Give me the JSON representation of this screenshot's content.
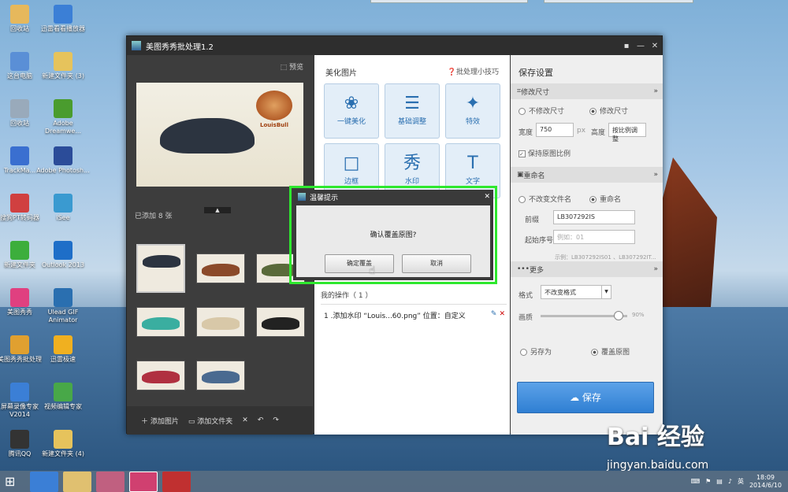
{
  "desktop_icons": [
    {
      "label": "回收站",
      "color": "#e6b85c"
    },
    {
      "label": "迅雷看看播放器",
      "color": "#3b7fd6"
    },
    {
      "label": "这台电脑",
      "color": "#5a8fd6"
    },
    {
      "label": "新建文件夹 (3)",
      "color": "#e6c35c"
    },
    {
      "label": "回收站",
      "color": "#9ab"
    },
    {
      "label": "Adobe Dreamwe...",
      "color": "#4a9c2e"
    },
    {
      "label": "TrackMa...",
      "color": "#3a6fd0"
    },
    {
      "label": "Adobe Photosh...",
      "color": "#2b4c99"
    },
    {
      "label": "搜狗PT转码器",
      "color": "#d04040"
    },
    {
      "label": "iSee",
      "color": "#3a9ad0"
    },
    {
      "label": "新建文件夹",
      "color": "#3cae3c"
    },
    {
      "label": "Outlook 2013",
      "color": "#1e6ec8"
    },
    {
      "label": "美图秀秀",
      "color": "#e04080"
    },
    {
      "label": "Ulead GIF Animator",
      "color": "#2a6fb0"
    },
    {
      "label": "美图秀秀批处理",
      "color": "#e0a030"
    },
    {
      "label": "迅雷极速",
      "color": "#f0b020"
    },
    {
      "label": "屏幕录像专家V2014",
      "color": "#3b7fd6"
    },
    {
      "label": "视频编辑专家",
      "color": "#48a848"
    },
    {
      "label": "腾讯QQ",
      "color": "#333"
    },
    {
      "label": "新建文件夹 (4)",
      "color": "#e6c35c"
    }
  ],
  "window": {
    "title": "美图秀秀批处理1.2",
    "title_buttons": [
      "▪",
      "—",
      "✕"
    ]
  },
  "left_panel": {
    "preview_label": "预览",
    "added_count": "已添加 8 张",
    "logo_text": "LouisBull",
    "thumb_colors": [
      "#2c3440",
      "#8b4a2a",
      "#5a6a3a",
      "#3aaea0",
      "#d8c8a8",
      "#222",
      "#b03040",
      "#4a6a90"
    ],
    "footer": {
      "add_image": "添加图片",
      "add_folder": "添加文件夹",
      "delete": "✕",
      "undo": "↶",
      "redo": "↷"
    }
  },
  "middle_panel": {
    "heading": "美化图片",
    "tips": "批处理小技巧",
    "tools": [
      {
        "label": "一键美化",
        "icon": "❀"
      },
      {
        "label": "基础调整",
        "icon": "☰"
      },
      {
        "label": "特效",
        "icon": "✦"
      },
      {
        "label": "边框",
        "icon": "□"
      },
      {
        "label": "水印",
        "icon": "秀"
      },
      {
        "label": "文字",
        "icon": "T"
      }
    ],
    "ops_title": "我的操作（ 1 ）",
    "ops": [
      {
        "text": "1 .添加水印 “Louis...60.png” 位置：自定义",
        "edit": "✎",
        "remove": "✕"
      }
    ]
  },
  "right_panel": {
    "heading": "保存设置",
    "resize": {
      "section": "修改尺寸",
      "no_change": "不修改尺寸",
      "change": "修改尺寸",
      "width_label": "宽度",
      "width_value": "750",
      "unit": "px",
      "height_label": "高度",
      "height_value": "按比例调整",
      "keep_ratio": "保持原图比例"
    },
    "rename": {
      "section": "重命名",
      "no_change": "不改变文件名",
      "rename": "重命名",
      "prefix_label": "前缀",
      "prefix_value": "LB307292IS",
      "start_label": "起始序号",
      "start_placeholder": "例如：01",
      "example": "示例：LB307292IS01 、LB307292IT..."
    },
    "more": {
      "section": "更多",
      "format_label": "格式",
      "format_value": "不改变格式",
      "quality_label": "画质",
      "quality": 0.9,
      "quality_text": "90%",
      "save_as": "另存为",
      "overwrite": "覆盖原图"
    },
    "save_button": "保存"
  },
  "dialog": {
    "title": "温馨提示",
    "message": "确认覆盖原图?",
    "confirm": "确定覆盖",
    "cancel": "取消"
  },
  "tray": {
    "ime": "英",
    "time": "18:09",
    "date": "2014/6/10"
  },
  "watermark": {
    "brand": "Bai 经验",
    "url": "jingyan.baidu.com"
  }
}
